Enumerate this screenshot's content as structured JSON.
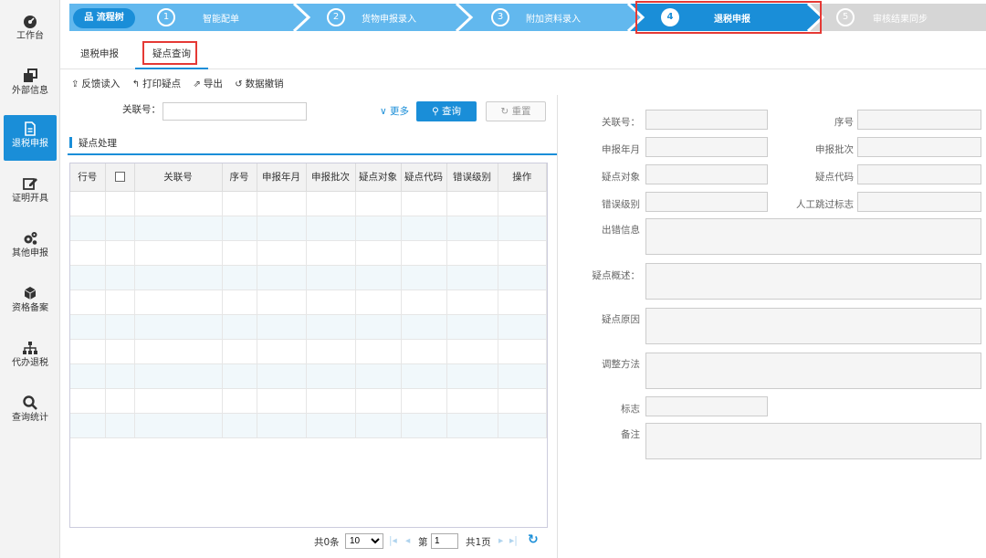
{
  "sidebar": {
    "items": [
      {
        "label": "工作台",
        "icon": "dashboard-icon"
      },
      {
        "label": "外部信息",
        "icon": "clone-icon"
      },
      {
        "label": "退税申报",
        "icon": "document-icon"
      },
      {
        "label": "证明开具",
        "icon": "edit-icon"
      },
      {
        "label": "其他申报",
        "icon": "gears-icon"
      },
      {
        "label": "资格备案",
        "icon": "cube-icon"
      },
      {
        "label": "代办退税",
        "icon": "sitemap-icon"
      },
      {
        "label": "查询统计",
        "icon": "search-icon"
      }
    ],
    "active_index": 2
  },
  "steps": {
    "tree_label": "流程树",
    "items": [
      {
        "num": "1",
        "label": "智能配单"
      },
      {
        "num": "2",
        "label": "货物申报录入"
      },
      {
        "num": "3",
        "label": "附加资料录入"
      },
      {
        "num": "4",
        "label": "退税申报"
      },
      {
        "num": "5",
        "label": "审核结果同步"
      }
    ]
  },
  "subtabs": [
    {
      "label": "退税申报"
    },
    {
      "label": "疑点查询"
    }
  ],
  "toolbar": {
    "feedback": "反馈读入",
    "print": "打印疑点",
    "export": "导出",
    "revoke": "数据撤销"
  },
  "search": {
    "label": "关联号：",
    "more": "更多",
    "query": "查询",
    "reset": "重置"
  },
  "section_title": "疑点处理",
  "table": {
    "columns": [
      "行号",
      "",
      "关联号",
      "序号",
      "申报年月",
      "申报批次",
      "疑点对象",
      "疑点代码",
      "错误级别",
      "操作"
    ]
  },
  "pager": {
    "total": "共0条",
    "page_size": "10",
    "page_prefix": "第",
    "page_value": "1",
    "page_total": "共1页"
  },
  "detail": {
    "fields": {
      "link_no": "关联号：",
      "seq": "序号",
      "period": "申报年月",
      "batch": "申报批次",
      "object": "疑点对象",
      "code": "疑点代码",
      "level": "错误级别",
      "skip_flag": "人工跳过标志",
      "error_info": "出错信息",
      "summary": "疑点概述：",
      "reason": "疑点原因",
      "method": "调整方法",
      "flag": "标志",
      "remark": "备注"
    }
  },
  "colors": {
    "accent": "#1a8ed8",
    "highlight": "#e53935",
    "step_inactive": "#62b8ee",
    "step_last": "#d6d6d6"
  }
}
